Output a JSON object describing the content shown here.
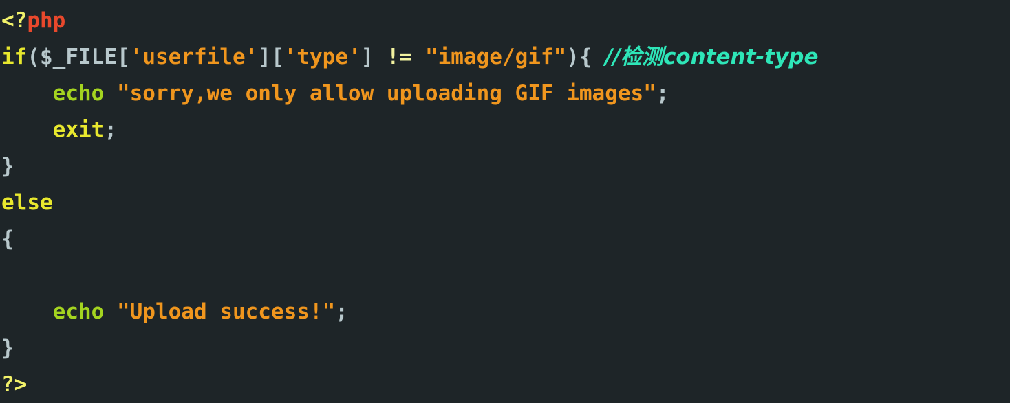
{
  "editor": {
    "language": "php",
    "background_color": "#1e2528",
    "font_style": "monospace-bold"
  },
  "colors": {
    "background": "#1e2528",
    "tag": "#f2f26a",
    "php_word": "#e8482c",
    "keyword": "#e8e82e",
    "echo": "#a4d420",
    "punctuation": "#b8c8cc",
    "variable": "#b8c8cc",
    "string": "#f0961e",
    "operator": "#f2f2a0",
    "comment": "#2ee6b8"
  },
  "code": {
    "line1": {
      "open_tag": "<?",
      "php_word": "php"
    },
    "line2": {
      "keyword": "if",
      "paren_open": "(",
      "variable": "$_FILE",
      "bracket1_open": "[",
      "key1": "'userfile'",
      "bracket1_close": "]",
      "bracket2_open": "[",
      "key2": "'type'",
      "bracket2_close": "]",
      "operator": "!=",
      "compare_value": "\"image/gif\"",
      "paren_close": ")",
      "brace_open": "{",
      "comment": "//检测content-type"
    },
    "line3": {
      "indent": "    ",
      "echo": "echo",
      "string": "\"sorry,we only allow uploading GIF images\"",
      "semicolon": ";"
    },
    "line4": {
      "indent": "    ",
      "keyword": "exit",
      "semicolon": ";"
    },
    "line5": {
      "brace_close": "}"
    },
    "line6": {
      "keyword": "else"
    },
    "line7": {
      "brace_open": "{"
    },
    "line8": {
      "indent": "    ",
      "echo": "echo",
      "string": "\"Upload success!\"",
      "semicolon": ";"
    },
    "line9": {
      "brace_close": "}"
    },
    "line10": {
      "close_tag": "?>"
    }
  }
}
